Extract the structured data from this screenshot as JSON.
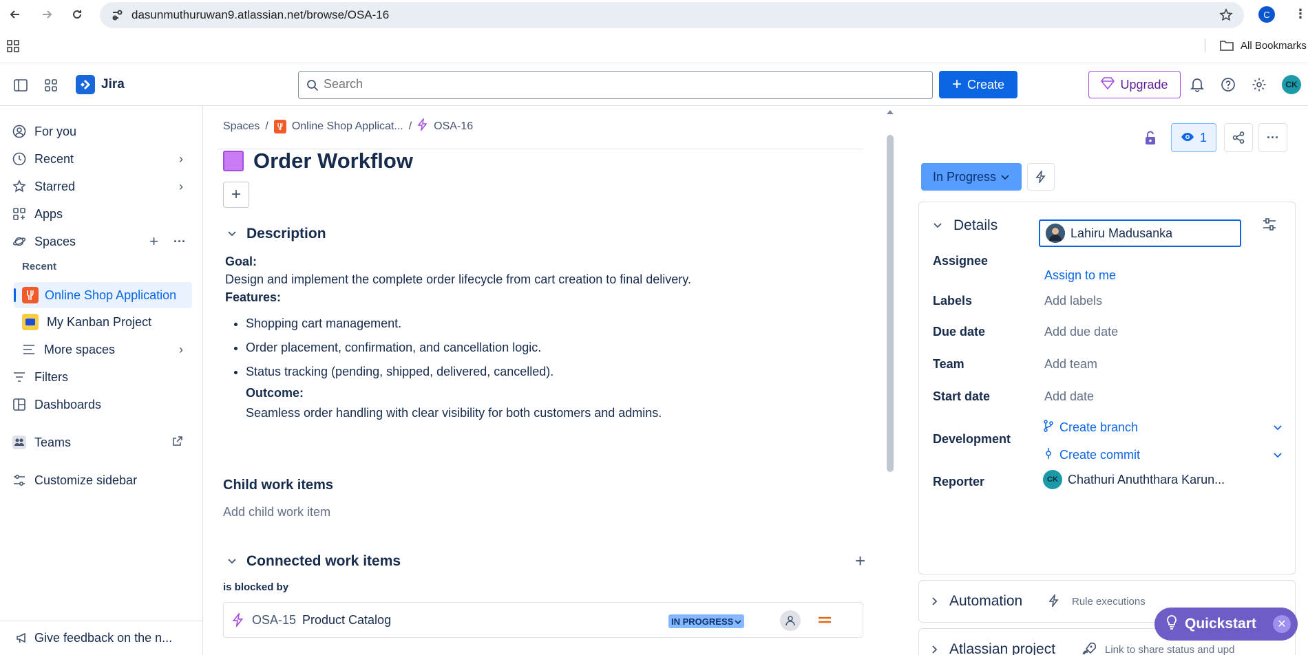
{
  "browser": {
    "url": "dasunmuthuruwan9.atlassian.net/browse/OSA-16",
    "profile_initial": "C",
    "bookmarks_label": "All Bookmarks"
  },
  "topnav": {
    "app_name": "Jira",
    "search_placeholder": "Search",
    "create_label": "Create",
    "upgrade_label": "Upgrade",
    "user_initials": "CK"
  },
  "sidebar": {
    "for_you": "For you",
    "recent": "Recent",
    "starred": "Starred",
    "apps": "Apps",
    "spaces": "Spaces",
    "recent_section": "Recent",
    "space_online_shop": "Online Shop Application",
    "space_kanban": "My Kanban Project",
    "more_spaces": "More spaces",
    "filters": "Filters",
    "dashboards": "Dashboards",
    "teams": "Teams",
    "customize": "Customize sidebar",
    "feedback": "Give feedback on the n..."
  },
  "breadcrumb": {
    "spaces": "Spaces",
    "project": "Online Shop Applicat...",
    "issue_key": "OSA-16"
  },
  "issue": {
    "title": "Order Workflow",
    "description_heading": "Description",
    "goal_label": "Goal:",
    "goal_text": "Design and implement the complete order lifecycle from cart creation to final delivery.",
    "features_label": "Features:",
    "features": [
      "Shopping cart management.",
      "Order placement, confirmation, and cancellation logic.",
      "Status tracking (pending, shipped, delivered, cancelled)."
    ],
    "outcome_label": "Outcome:",
    "outcome_text": "Seamless order handling with clear visibility for both customers and admins.",
    "child_heading": "Child work items",
    "child_add": "Add child work item",
    "connected_heading": "Connected work items",
    "blocked_by_label": "is blocked by",
    "linked_key": "OSA-15",
    "linked_title": "Product Catalog",
    "linked_status": "IN PROGRESS"
  },
  "panel": {
    "watch_count": "1",
    "status": "In Progress",
    "details_heading": "Details",
    "assignee_label": "Assignee",
    "assignee_name": "Lahiru Madusanka",
    "assign_to_me": "Assign to me",
    "labels_label": "Labels",
    "labels_value": "Add labels",
    "due_label": "Due date",
    "due_value": "Add due date",
    "team_label": "Team",
    "team_value": "Add team",
    "start_label": "Start date",
    "start_value": "Add date",
    "dev_label": "Development",
    "create_branch": "Create branch",
    "create_commit": "Create commit",
    "reporter_label": "Reporter",
    "reporter_initials": "CK",
    "reporter_name": "Chathuri Anuththara Karun...",
    "automation_heading": "Automation",
    "automation_sub": "Rule executions",
    "atlassian_heading": "Atlassian project",
    "atlassian_sub": "Link to share status and upd"
  },
  "quickstart": {
    "label": "Quickstart"
  },
  "colors": {
    "primary": "#0c66e4",
    "status_blue": "#579dff",
    "epic_purple": "#c97cf4",
    "quickstart": "#6e5dc6"
  }
}
